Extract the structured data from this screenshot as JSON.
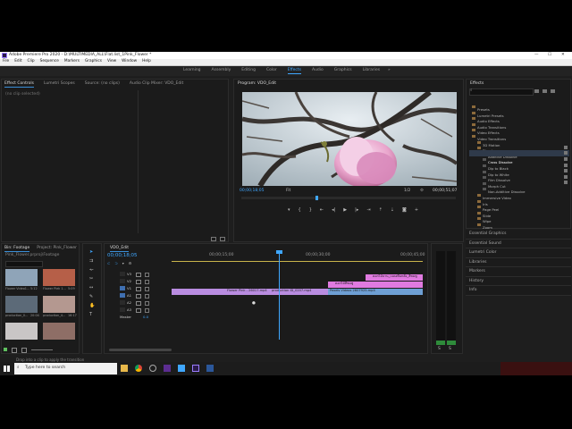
{
  "title_bar": {
    "title": "Adobe Premiere Pro 2020 - D:\\MULTIMEDIA_ALL\\Flat.list_1Pink_Flower *",
    "minimize": "—",
    "maximize": "☐",
    "close": "✕"
  },
  "menu": [
    "File",
    "Edit",
    "Clip",
    "Sequence",
    "Markers",
    "Graphics",
    "View",
    "Window",
    "Help"
  ],
  "workspaces": [
    "Learning",
    "Assembly",
    "Editing",
    "Color",
    "Effects",
    "Audio",
    "Graphics",
    "Libraries"
  ],
  "active_workspace": "Effects",
  "workspace_more": "»",
  "source_panel": {
    "tabs": [
      "Effect Controls",
      "Lumetri Scopes",
      "Source: (no clips)",
      "Audio Clip Mixer: VDO_Edit"
    ],
    "active_tab": "Effect Controls",
    "empty_text": "(no clip selected)"
  },
  "program_monitor": {
    "title": "Program: VDO_Edit",
    "timecode_current": "00;00;18;05",
    "fit": "Fit",
    "resolution": "1/2",
    "timecode_total": "00;00;51;07"
  },
  "effects_panel": {
    "title": "Effects",
    "tree": [
      {
        "label": "Presets",
        "kind": "folder",
        "indent": 0
      },
      {
        "label": "Lumetri Presets",
        "kind": "folder",
        "indent": 0
      },
      {
        "label": "Audio Effects",
        "kind": "folder",
        "indent": 0
      },
      {
        "label": "Audio Transitions",
        "kind": "folder",
        "indent": 0
      },
      {
        "label": "Video Effects",
        "kind": "folder",
        "indent": 0
      },
      {
        "label": "Video Transitions",
        "kind": "folder",
        "indent": 0
      },
      {
        "label": "3D Motion",
        "kind": "folder",
        "indent": 1
      },
      {
        "label": "Dissolve",
        "kind": "folder",
        "indent": 1
      },
      {
        "label": "Additive Dissolve",
        "kind": "effect",
        "indent": 2
      },
      {
        "label": "Cross Dissolve",
        "kind": "effect",
        "indent": 2,
        "selected": true
      },
      {
        "label": "Dip to Black",
        "kind": "effect",
        "indent": 2
      },
      {
        "label": "Dip to White",
        "kind": "effect",
        "indent": 2
      },
      {
        "label": "Film Dissolve",
        "kind": "effect",
        "indent": 2
      },
      {
        "label": "Morph Cut",
        "kind": "effect",
        "indent": 2
      },
      {
        "label": "Non-Additive Dissolve",
        "kind": "effect",
        "indent": 2
      },
      {
        "label": "Immersive Video",
        "kind": "folder",
        "indent": 1
      },
      {
        "label": "Iris",
        "kind": "folder",
        "indent": 1
      },
      {
        "label": "Page Peel",
        "kind": "folder",
        "indent": 1
      },
      {
        "label": "Slide",
        "kind": "folder",
        "indent": 1
      },
      {
        "label": "Wipe",
        "kind": "folder",
        "indent": 1
      },
      {
        "label": "Zoom",
        "kind": "folder",
        "indent": 1
      }
    ],
    "side_panels": [
      "Essential Graphics",
      "Essential Sound",
      "Lumetri Color",
      "Libraries",
      "Markers",
      "History",
      "Info"
    ]
  },
  "project_panel": {
    "tabs": [
      "Bin: Footage",
      "Project: Pink_Flower"
    ],
    "path": "Pink_Flower.prproj\\Footage",
    "items": [
      {
        "name": "Flower Video1...",
        "dur": "5:12",
        "color": "#8fa4b8"
      },
      {
        "name": "Flower Piek 1...",
        "dur": "5:09",
        "color": "#b65f48"
      },
      {
        "name": "production_0...",
        "dur": "20:04",
        "color": "#5c6a78"
      },
      {
        "name": "production_4...",
        "dur": "16:17",
        "color": "#b49890"
      },
      {
        "name": "",
        "dur": "",
        "color": "#c9c6c6"
      },
      {
        "name": "",
        "dur": "",
        "color": "#8e6e66"
      }
    ]
  },
  "timeline": {
    "tab": "VDO_Edit",
    "timecode": "00;00;18;05",
    "ruler_labels": [
      "00;00;15;00",
      "00;00;30;00",
      "00;00;45;00"
    ],
    "video_tracks": [
      "V3",
      "V2",
      "V1"
    ],
    "audio_tracks": [
      "A1",
      "A2",
      "A3"
    ],
    "master": "Master",
    "master_value": "0.0",
    "clips": [
      {
        "label": "ดอกไม้บาน_เบลอพื้นหลัง_สีชมพู",
        "track": "V3",
        "kind": "pink"
      },
      {
        "label": "ดอกไม้สีชมพู",
        "track": "V2",
        "kind": "pink"
      },
      {
        "label": "Flower Pink - 26017.mp4",
        "track": "V1",
        "kind": "violet"
      },
      {
        "label": "production ID_0207.mp4",
        "track": "V1",
        "kind": "violet"
      },
      {
        "label": "Pexels Videos 2607925.mp4",
        "track": "V1",
        "kind": "blue"
      }
    ]
  },
  "status_bar": "Drop into a clip to apply the transition",
  "taskbar": {
    "search_placeholder": "Type here to search",
    "apps": [
      "File Explorer",
      "Chrome",
      "Firefox",
      "Visual Studio",
      "Photos",
      "Premiere Pro",
      "Word"
    ]
  },
  "colors": {
    "accent_blue": "#3fa7ff",
    "clip_violet": "#b98ce0",
    "clip_pink": "#e07ae0",
    "clip_blue": "#6e9fd4"
  }
}
